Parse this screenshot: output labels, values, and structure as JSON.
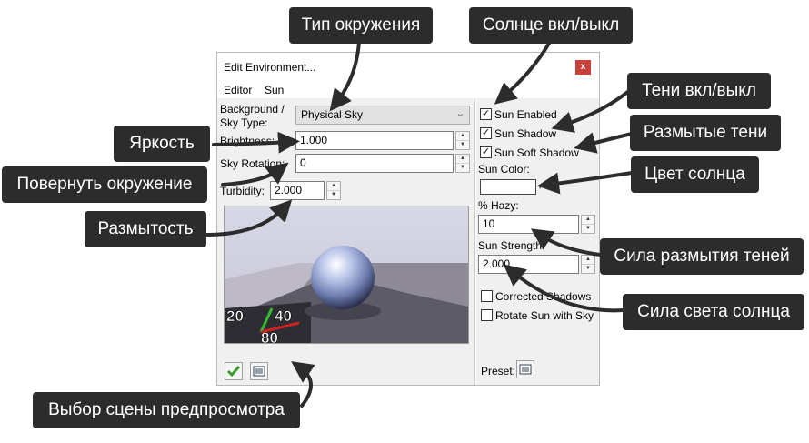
{
  "dialog": {
    "title": "Edit Environment...",
    "close_label": "x",
    "menu": [
      "Editor",
      "Sun"
    ],
    "left": {
      "background_label_line1": "Background /",
      "background_label_line2": "Sky Type:",
      "sky_type_value": "Physical Sky",
      "brightness_label": "Brightness:",
      "brightness_value": "1.000",
      "sky_rotation_label": "Sky Rotation:",
      "sky_rotation_value": "0",
      "turbidity_label": "Turbidity:",
      "turbidity_value": "2.000"
    },
    "right": {
      "sun_enabled_label": "Sun Enabled",
      "sun_enabled_checked": true,
      "sun_shadow_label": "Sun Shadow",
      "sun_shadow_checked": true,
      "sun_soft_shadow_label": "Sun Soft Shadow",
      "sun_soft_shadow_checked": true,
      "sun_color_label": "Sun Color:",
      "sun_color_value": "#ffffff",
      "hazy_label": "% Hazy:",
      "hazy_value": "10",
      "sun_strength_label": "Sun Strength:",
      "sun_strength_value": "2.000",
      "corrected_shadows_label": "Corrected Shadows",
      "corrected_shadows_checked": false,
      "rotate_sun_label": "Rotate Sun with Sky",
      "rotate_sun_checked": false,
      "preset_label": "Preset:"
    },
    "preview_numbers": [
      "20",
      "40",
      "80"
    ]
  },
  "callouts": {
    "env_type": "Тип окружения",
    "sun_toggle": "Солнце вкл/выкл",
    "shadows_toggle": "Тени вкл/выкл",
    "soft_shadows": "Размытые тени",
    "brightness": "Яркость",
    "rotate_env": "Повернуть окружение",
    "sun_color": "Цвет солнца",
    "blur": "Размытость",
    "shadow_blur_strength": "Сила размытия теней",
    "sun_strength": "Сила света солнца",
    "preview_scene": "Выбор сцены предпросмотра"
  },
  "colors": {
    "callout_bg": "#2c2c2c",
    "close_red": "#c7403a",
    "check_green": "#3a9a2a"
  }
}
